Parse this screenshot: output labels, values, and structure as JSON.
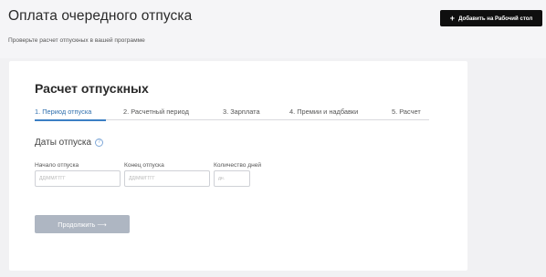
{
  "header": {
    "title": "Оплата очередного отпуска",
    "subtitle": "Проверьте расчет отпускных в вашей программе",
    "add_button": {
      "icon": "plus-icon",
      "label": "Добавить на Рабочий стол"
    }
  },
  "card": {
    "title": "Расчет отпускных",
    "steps": [
      {
        "label": "1. Период отпуска",
        "active": true
      },
      {
        "label": "2. Расчетный период",
        "active": false
      },
      {
        "label": "3. Зарплата",
        "active": false
      },
      {
        "label": "4. Премии и надбавки",
        "active": false
      },
      {
        "label": "5. Расчет",
        "active": false
      }
    ],
    "section": {
      "title": "Даты отпуска",
      "help_icon": "question-circle-icon"
    },
    "fields": {
      "start": {
        "label": "Начало отпуска",
        "placeholder": "ДД/ММ/ГГГГ"
      },
      "end": {
        "label": "Конец отпуска",
        "placeholder": "ДД/ММ/ГГГГ"
      },
      "days": {
        "label": "Количество дней",
        "placeholder": "дн."
      }
    },
    "continue_button": {
      "label": "Продолжить ⟶"
    }
  },
  "colors": {
    "accent": "#3b7fc4",
    "button_dark": "#0f0f0f",
    "button_disabled": "#aeb6c2"
  }
}
